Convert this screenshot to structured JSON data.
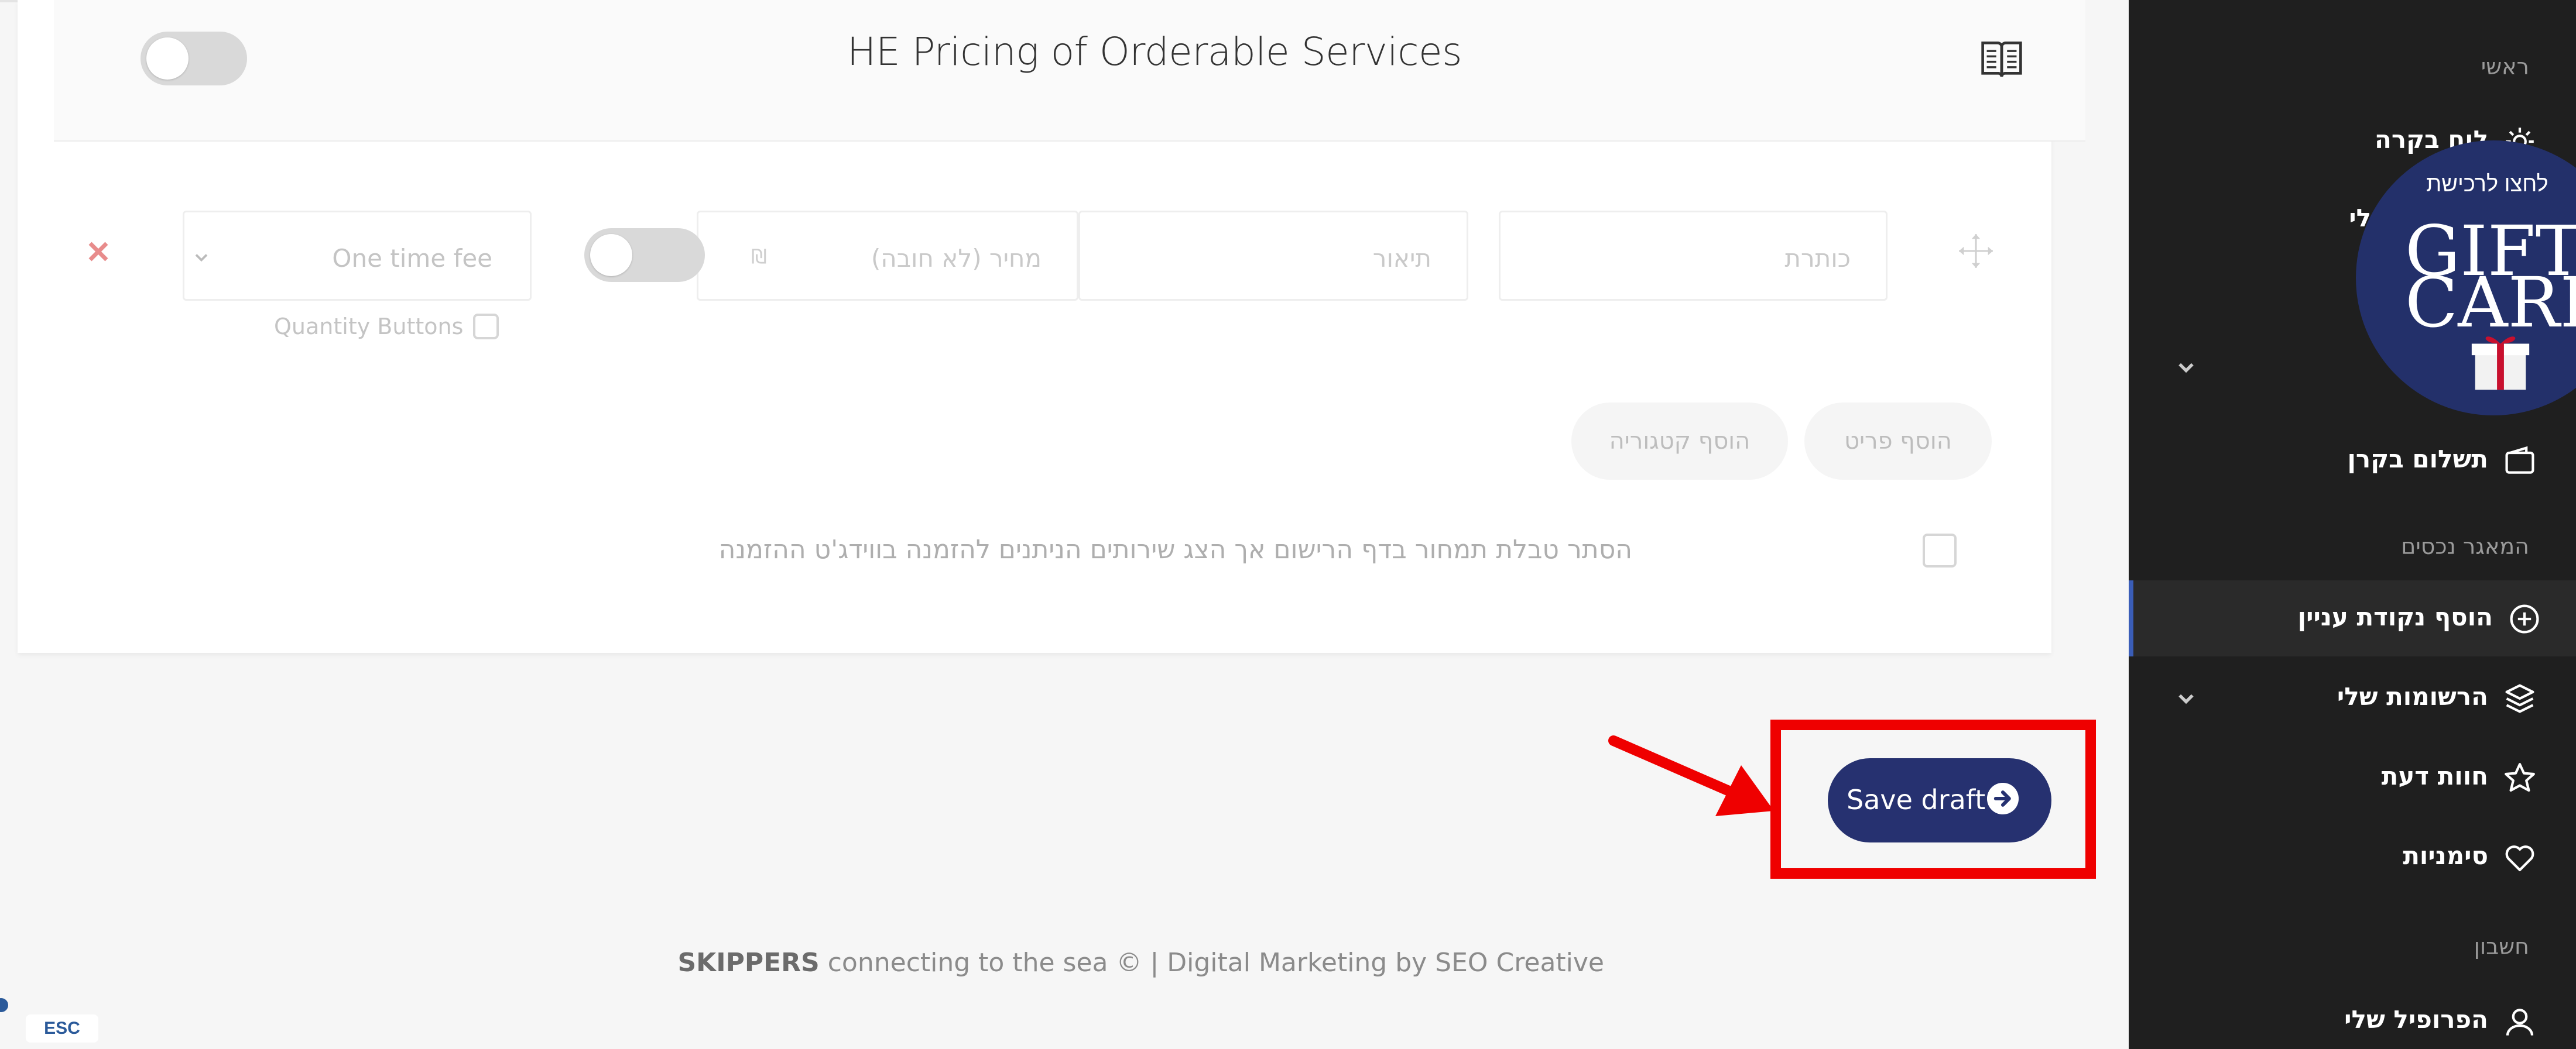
{
  "section": {
    "title": "HE Pricing of Orderable Services"
  },
  "item_row": {
    "title_placeholder": "כותרת",
    "description_placeholder": "תיאור",
    "price_placeholder": "מחיר (לא חובה)",
    "currency_symbol": "₪",
    "fee_select_value": "One time fee",
    "quantity_buttons_label": "Quantity Buttons"
  },
  "actions": {
    "add_item": "הוסף פריט",
    "add_category": "הוסף קטגוריה"
  },
  "hide_table_label": "הסתר טבלת תמחור בדף הרישום אך הצג שירותים הניתנים להזמנה בווידג'ט ההזמנה",
  "save": {
    "label": "Save draft"
  },
  "footer": {
    "brand": "SKIPPERS",
    "text": " connecting to the sea © | Digital Marketing by SEO Creative"
  },
  "esc_badge": "ESC",
  "sidebar": {
    "heading_main": "ראשי",
    "item_dashboard": "לוח בקרה",
    "item_partial": "לי",
    "item_payment": "תשלום בקרן",
    "heading_listings": "המאגר נכסים",
    "item_add_poi": "הוסף נקודת עניין",
    "item_my_listings": "הרשומות שלי",
    "item_reviews": "חוות דעת",
    "item_bookmarks": "סימניות",
    "heading_account": "חשבון",
    "item_profile": "הפרופיל שלי"
  },
  "gift_card": {
    "top_text": "לחצו לרכישת",
    "word1": "GIFT",
    "word2": "CARD"
  },
  "colors": {
    "accent_navy": "#263170",
    "highlight_red": "#ef0000",
    "sidebar_bg": "#1f1f1f",
    "active_indicator": "#3a5db7"
  }
}
